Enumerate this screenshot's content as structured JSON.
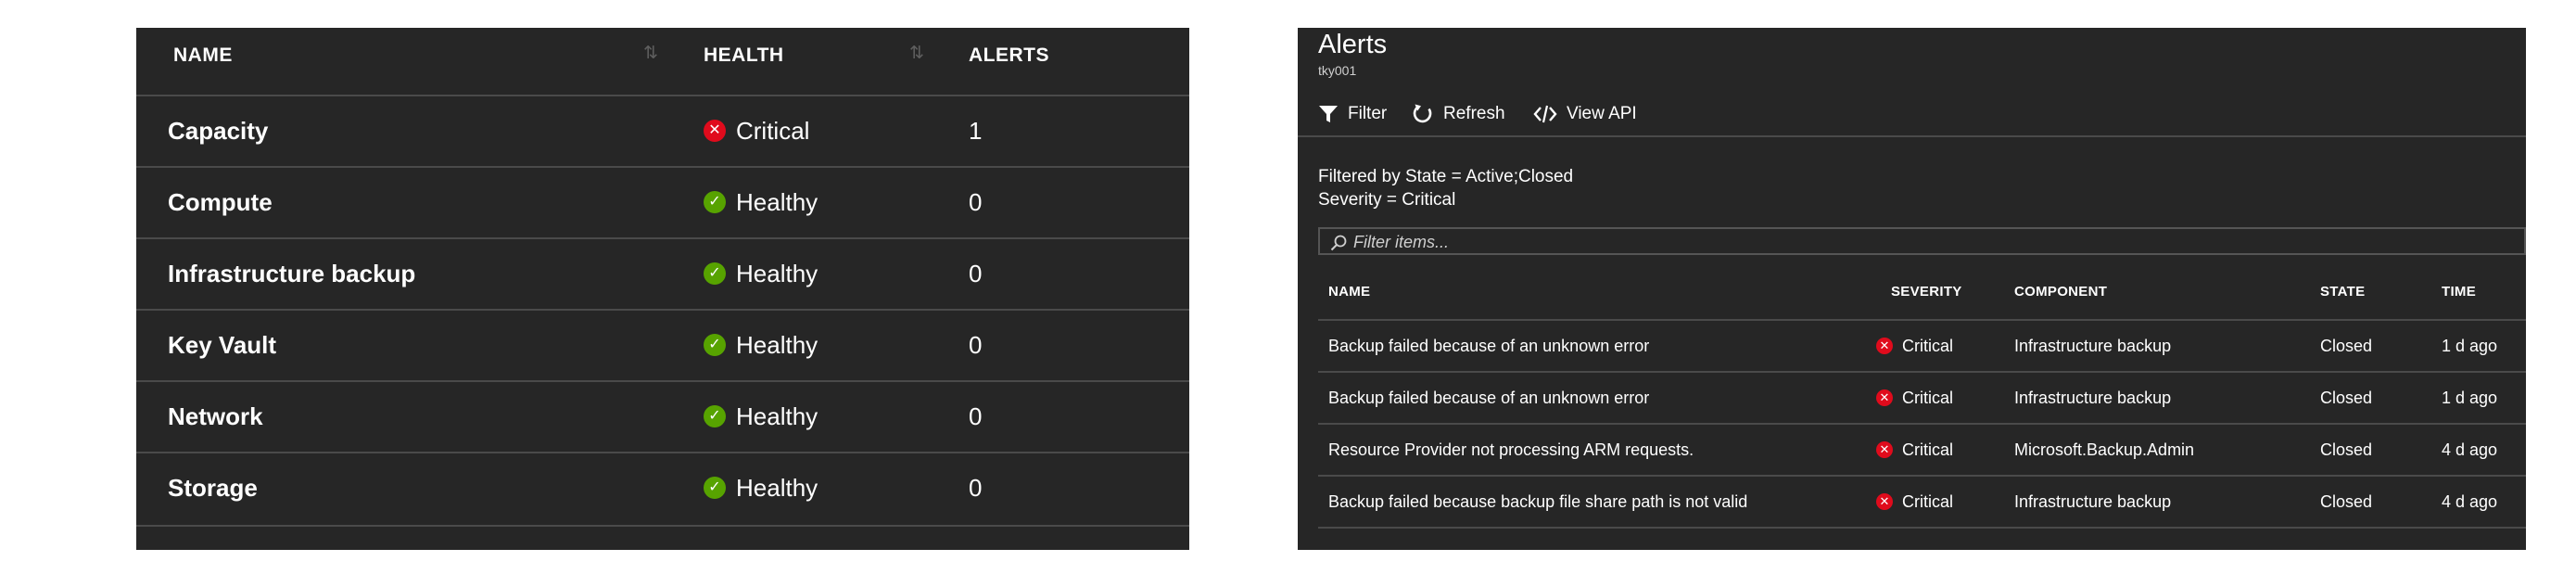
{
  "health_table": {
    "headers": {
      "name": "NAME",
      "health": "HEALTH",
      "alerts": "ALERTS"
    },
    "rows": [
      {
        "name": "Capacity",
        "health": "Critical",
        "alerts": "1",
        "status_icon": "critical-icon"
      },
      {
        "name": "Compute",
        "health": "Healthy",
        "alerts": "0",
        "status_icon": "healthy-check-icon"
      },
      {
        "name": "Infrastructure backup",
        "health": "Healthy",
        "alerts": "0",
        "status_icon": "healthy-check-icon"
      },
      {
        "name": "Key Vault",
        "health": "Healthy",
        "alerts": "0",
        "status_icon": "healthy-check-icon"
      },
      {
        "name": "Network",
        "health": "Healthy",
        "alerts": "0",
        "status_icon": "healthy-check-icon"
      },
      {
        "name": "Storage",
        "health": "Healthy",
        "alerts": "0",
        "status_icon": "healthy-check-icon"
      }
    ]
  },
  "alerts_blade": {
    "title": "Alerts",
    "subtitle": "tky001",
    "toolbar": {
      "filter": "Filter",
      "refresh": "Refresh",
      "view_api": "View API"
    },
    "filter_summary": {
      "line1": "Filtered by State = Active;Closed",
      "line2": "Severity = Critical"
    },
    "search": {
      "placeholder": "Filter items..."
    },
    "headers": {
      "name": "NAME",
      "severity": "SEVERITY",
      "component": "COMPONENT",
      "state": "STATE",
      "time": "TIME"
    },
    "rows": [
      {
        "name": "Backup failed because of an unknown error",
        "severity": "Critical",
        "component": "Infrastructure backup",
        "state": "Closed",
        "time": "1 d ago"
      },
      {
        "name": "Backup failed because of an unknown error",
        "severity": "Critical",
        "component": "Infrastructure backup",
        "state": "Closed",
        "time": "1 d ago"
      },
      {
        "name": "Resource Provider not processing ARM requests.",
        "severity": "Critical",
        "component": "Microsoft.Backup.Admin",
        "state": "Closed",
        "time": "4 d ago"
      },
      {
        "name": "Backup failed because backup file share path is not valid",
        "severity": "Critical",
        "component": "Infrastructure backup",
        "state": "Closed",
        "time": "4 d ago"
      }
    ]
  },
  "colors": {
    "panel_bg": "#262626",
    "healthy": "#57a300",
    "critical": "#e00b1c",
    "divider": "#4a4a4a"
  }
}
